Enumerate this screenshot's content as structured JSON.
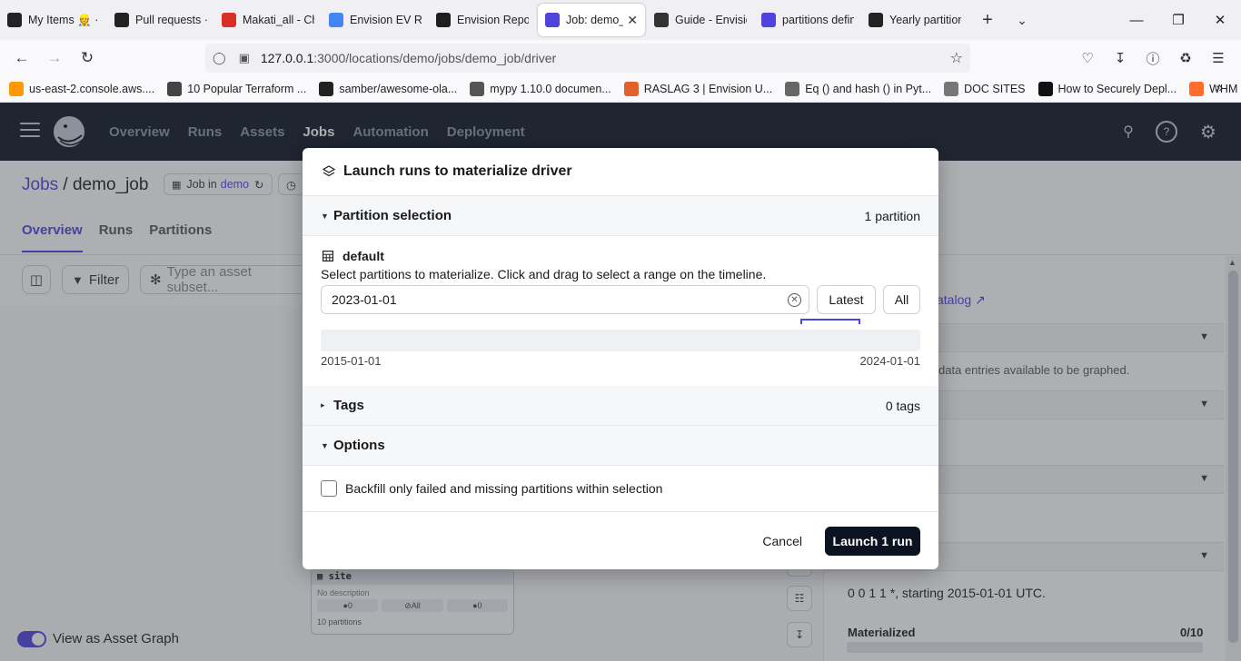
{
  "browser": {
    "tabs": [
      {
        "title": "My Items 👷 · E",
        "icon": "github-icon",
        "color": "#222222"
      },
      {
        "title": "Pull requests · S",
        "icon": "github-icon",
        "color": "#222222"
      },
      {
        "title": "Makati_all - Ch",
        "icon": "gmail-icon",
        "color": "#d93025"
      },
      {
        "title": "Envision EV Re",
        "icon": "docs-icon",
        "color": "#4285f4"
      },
      {
        "title": "Envision Report",
        "icon": "figma-icon",
        "color": "#1e1e1e"
      },
      {
        "title": "Job: demo_jc",
        "icon": "dagster-icon",
        "color": "#4f43dd",
        "active": true
      },
      {
        "title": "Guide - Envisio",
        "icon": "notion-icon",
        "color": "#333333"
      },
      {
        "title": "partitions defin",
        "icon": "dagster-icon",
        "color": "#4f43dd"
      },
      {
        "title": "Yearly partition",
        "icon": "github-icon",
        "color": "#222222"
      }
    ],
    "url_prefix": "127.0.0.1",
    "url_rest": ":3000/locations/demo/jobs/demo_job/driver",
    "bookmarks": [
      {
        "label": "us-east-2.console.aws....",
        "color": "#f90"
      },
      {
        "label": "10 Popular Terraform ...",
        "color": "#444"
      },
      {
        "label": "samber/awesome-ola...",
        "color": "#222"
      },
      {
        "label": "mypy 1.10.0 documen...",
        "color": "#555"
      },
      {
        "label": "RASLAG 3 | Envision U...",
        "color": "#e2612a"
      },
      {
        "label": "Eq () and hash () in Pyt...",
        "color": "#666"
      },
      {
        "label": "DOC SITES",
        "color": "#777"
      },
      {
        "label": "How to Securely Depl...",
        "color": "#111"
      },
      {
        "label": "WHM Login",
        "color": "#ff6c2c"
      }
    ]
  },
  "app": {
    "nav": [
      "Overview",
      "Runs",
      "Assets",
      "Jobs",
      "Automation",
      "Deployment"
    ],
    "active_nav": "Jobs"
  },
  "page": {
    "crumb_root": "Jobs",
    "crumb_sep": " / ",
    "crumb_job": "demo_job",
    "job_chip_prefix": "Job in",
    "job_chip_location": "demo",
    "subtabs": [
      "Overview",
      "Runs",
      "Partitions"
    ],
    "filter_label": "Filter",
    "subset_placeholder": "Type an asset subset...",
    "catalog_link": "atalog",
    "no_data_text": "data entries available to be graphed.",
    "schedule_text": "0 0 1 1 *, starting 2015-01-01 UTC.",
    "materialized_label": "Materialized",
    "materialized_count": "0/10",
    "node": {
      "name": "site",
      "desc": "No description",
      "stat1": "0",
      "stat2": "All",
      "stat3": "0",
      "footer": "10 partitions"
    },
    "toggle_label": "View as Asset Graph"
  },
  "modal": {
    "title": "Launch runs to materialize driver",
    "partition_section": "Partition selection",
    "partition_count": "1 partition",
    "partition_set_name": "default",
    "instructions": "Select partitions to materialize. Click and drag to select a range on the timeline.",
    "selection_value": "2023-01-01",
    "latest_label": "Latest",
    "all_label": "All",
    "timeline_start": "2015-01-01",
    "timeline_end": "2024-01-01",
    "tags_section": "Tags",
    "tags_count": "0 tags",
    "options_section": "Options",
    "backfill_option": "Backfill only failed and missing partitions within selection",
    "cancel_label": "Cancel",
    "launch_label": "Launch 1 run"
  }
}
